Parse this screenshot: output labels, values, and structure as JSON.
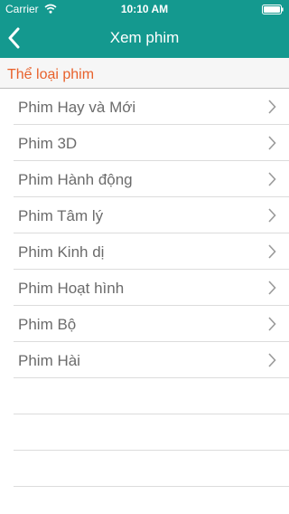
{
  "status_bar": {
    "carrier": "Carrier",
    "time": "10:10 AM"
  },
  "nav": {
    "title": "Xem phim"
  },
  "section": {
    "title": "Thể loại phim"
  },
  "categories": [
    {
      "label": "Phim Hay và Mới"
    },
    {
      "label": "Phim 3D"
    },
    {
      "label": "Phim Hành động"
    },
    {
      "label": "Phim Tâm lý"
    },
    {
      "label": "Phim Kinh dị"
    },
    {
      "label": "Phim Hoạt hình"
    },
    {
      "label": "Phim Bộ"
    },
    {
      "label": "Phim Hài"
    }
  ],
  "colors": {
    "header": "#14998f",
    "section_title": "#e8612b",
    "row_text": "#6b6b6b"
  },
  "icons": [
    "wifi-icon",
    "battery-icon",
    "back-chevron-icon",
    "chevron-right-icon"
  ]
}
